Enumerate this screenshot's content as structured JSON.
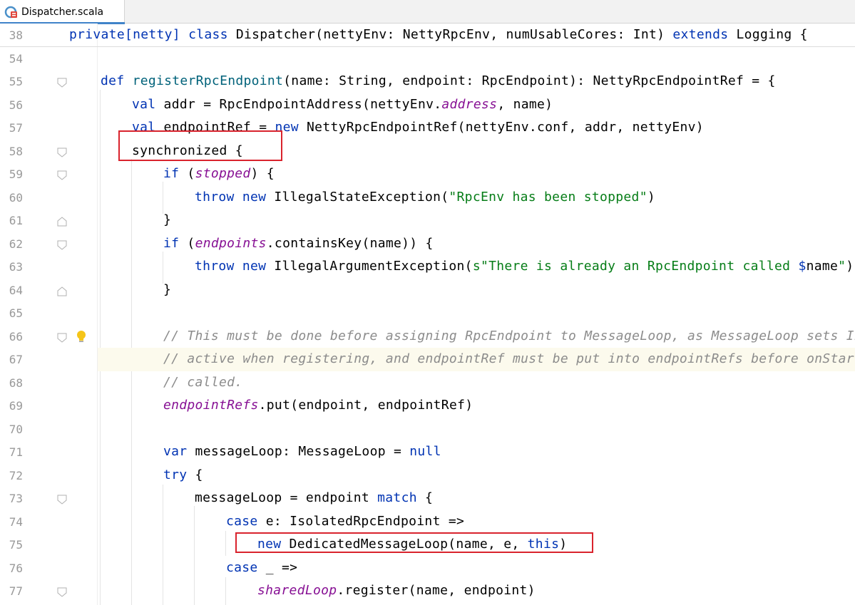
{
  "tab": {
    "title": "Dispatcher.scala",
    "icon": "scala-file-icon"
  },
  "lines": [
    {
      "num": "38"
    },
    {
      "num": "54"
    },
    {
      "num": "55"
    },
    {
      "num": "56"
    },
    {
      "num": "57"
    },
    {
      "num": "58"
    },
    {
      "num": "59"
    },
    {
      "num": "60"
    },
    {
      "num": "61"
    },
    {
      "num": "62"
    },
    {
      "num": "63"
    },
    {
      "num": "64"
    },
    {
      "num": "65"
    },
    {
      "num": "66"
    },
    {
      "num": "67"
    },
    {
      "num": "68"
    },
    {
      "num": "69"
    },
    {
      "num": "70"
    },
    {
      "num": "71"
    },
    {
      "num": "72"
    },
    {
      "num": "73"
    },
    {
      "num": "74"
    },
    {
      "num": "75"
    },
    {
      "num": "76"
    },
    {
      "num": "77"
    }
  ],
  "code": {
    "l38": [
      "private[netty] ",
      "class",
      " Dispatcher(nettyEnv: NettyRpcEnv, numUsableCores: Int) ",
      "extends",
      " Logging {"
    ],
    "l55": [
      "def",
      " ",
      "registerRpcEndpoint",
      "(name: String, endpoint: RpcEndpoint): NettyRpcEndpointRef = {"
    ],
    "l56": [
      "val",
      " addr = RpcEndpointAddress(nettyEnv.",
      "address",
      ", name)"
    ],
    "l57": [
      "val",
      " endpointRef = ",
      "new",
      " NettyRpcEndpointRef(nettyEnv.conf, addr, nettyEnv)"
    ],
    "l58": [
      "synchronized {"
    ],
    "l59": [
      "if",
      " (",
      "stopped",
      ") {"
    ],
    "l60": [
      "throw",
      " ",
      "new",
      " IllegalStateException(",
      "\"RpcEnv has been stopped\"",
      ")"
    ],
    "l61": [
      "}"
    ],
    "l62": [
      "if",
      " (",
      "endpoints",
      ".containsKey(name)) {"
    ],
    "l63": [
      "throw",
      " ",
      "new",
      " IllegalArgumentException(",
      "s\"There is already an RpcEndpoint called ",
      "$",
      "name",
      "\"",
      ")"
    ],
    "l64": [
      "}"
    ],
    "l66": [
      "// This must be done before assigning RpcEndpoint to MessageLoop, as MessageLoop sets Inb"
    ],
    "l67": [
      "// active when registering, and endpointRef must be put into endpointRefs before onStart i"
    ],
    "l68": [
      "// called."
    ],
    "l69": [
      "endpointRefs",
      ".put(endpoint, endpointRef)"
    ],
    "l71": [
      "var",
      " messageLoop: MessageLoop = ",
      "null"
    ],
    "l72": [
      "try",
      " {"
    ],
    "l73": [
      "messageLoop = endpoint ",
      "match",
      " {"
    ],
    "l74": [
      "case",
      " e: IsolatedRpcEndpoint =>"
    ],
    "l75": [
      "new",
      " DedicatedMessageLoop(name, e, ",
      "this",
      ")"
    ],
    "l76": [
      "case",
      " _ =>"
    ],
    "l77": [
      "sharedLoop",
      ".register(name, endpoint)"
    ]
  },
  "colors": {
    "keyword": "#0033b3",
    "string": "#067d17",
    "comment": "#8c8c8c",
    "field": "#871094",
    "highlight_box": "#d9232d",
    "current_line": "#fcfaed"
  },
  "gutter_icons": [
    "fold-icon",
    "bulb-icon"
  ]
}
